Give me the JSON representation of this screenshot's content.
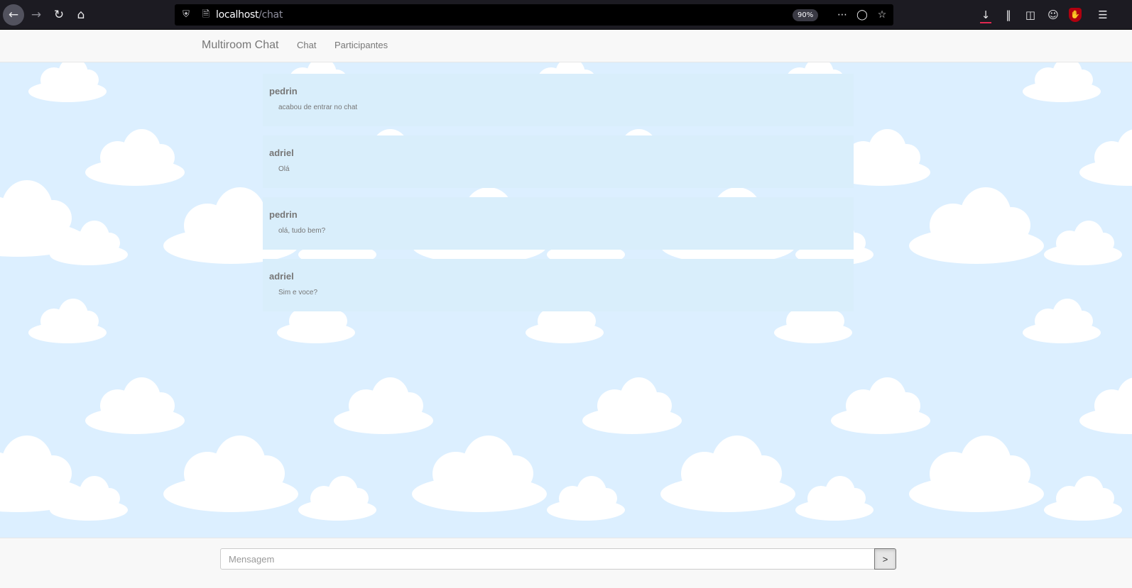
{
  "browser": {
    "url_host": "localhost",
    "url_path": "/chat",
    "zoom": "90%",
    "icons": [
      "back-icon",
      "forward-icon",
      "reload-icon",
      "home-icon",
      "shield-icon",
      "page-icon",
      "more-icon",
      "pocket-icon",
      "star-icon",
      "download-icon",
      "library-icon",
      "sidebar-icon",
      "account-icon",
      "ublock-icon",
      "menu-icon"
    ]
  },
  "navbar": {
    "brand": "Multiroom Chat",
    "links": [
      {
        "label": "Chat"
      },
      {
        "label": "Participantes"
      }
    ]
  },
  "messages": [
    {
      "user": "pedrin",
      "text": "acabou de entrar no chat"
    },
    {
      "user": "adriel",
      "text": "Olá"
    },
    {
      "user": "pedrin",
      "text": "olá, tudo bem?"
    },
    {
      "user": "adriel",
      "text": "Sim e voce?"
    }
  ],
  "composer": {
    "placeholder": "Mensagem",
    "value": "",
    "send_label": ">"
  },
  "colors": {
    "sky": "#dcefff",
    "message_bg": "#d9eefb",
    "browser_chrome": "#1c1b22"
  }
}
